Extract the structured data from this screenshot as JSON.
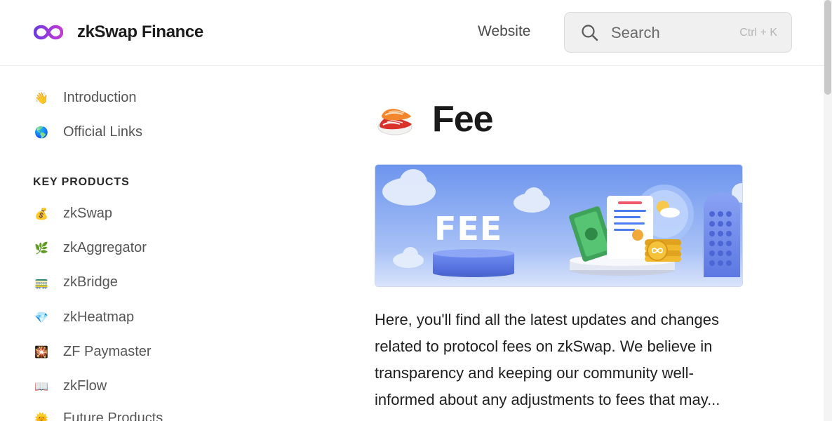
{
  "header": {
    "brand_name": "zkSwap Finance",
    "website_label": "Website",
    "search": {
      "placeholder": "Search",
      "shortcut": "Ctrl + K"
    }
  },
  "sidebar": {
    "top_items": [
      {
        "label": "Introduction",
        "emoji": "👋"
      },
      {
        "label": "Official Links",
        "emoji": "🌎"
      }
    ],
    "section_title": "KEY PRODUCTS",
    "items": [
      {
        "label": "zkSwap",
        "emoji": "💰"
      },
      {
        "label": "zkAggregator",
        "emoji": "🌿"
      },
      {
        "label": "zkBridge",
        "emoji": "🚃"
      },
      {
        "label": "zkHeatmap",
        "emoji": "💎"
      },
      {
        "label": "ZF Paymaster",
        "emoji": "🎇"
      },
      {
        "label": "zkFlow",
        "emoji": "📖"
      },
      {
        "label": "Future Products",
        "emoji": "🌞"
      }
    ]
  },
  "main": {
    "title": "Fee",
    "title_emoji": "🍣",
    "banner_text": "FEE",
    "intro": "Here, you'll find all the latest updates and changes related to protocol fees on zkSwap. We believe in transparency and keeping our community well-informed about any adjustments to fees that may..."
  },
  "colors": {
    "brand_logo_start": "#7b3fe4",
    "brand_logo_end": "#c03ad6",
    "banner_sky": "#7fa3f2"
  }
}
